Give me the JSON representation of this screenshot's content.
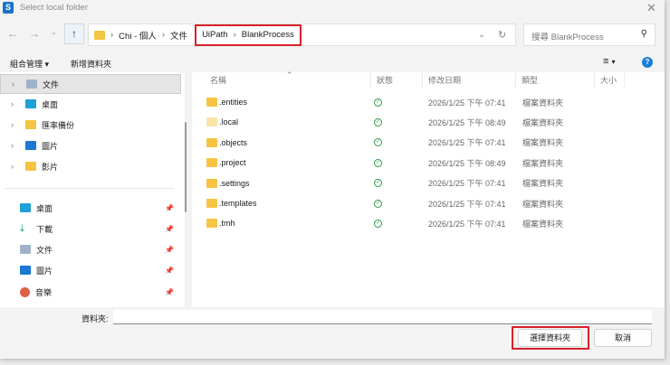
{
  "window": {
    "title": "Select local folder",
    "logo": "S"
  },
  "address": {
    "crumbs": [
      "Chi - 個人",
      "文件"
    ],
    "highlighted": [
      "UiPath",
      "BlankProcess"
    ]
  },
  "search": {
    "placeholder": "搜尋 BlankProcess"
  },
  "toolbar": {
    "organize": "組合管理",
    "new_folder": "新增資料夾"
  },
  "sidebar": {
    "tree": [
      {
        "label": "文件",
        "icon": "documents-icon"
      },
      {
        "label": "桌面",
        "icon": "desktop-icon"
      },
      {
        "label": "匯率備份",
        "icon": "folder-icon"
      },
      {
        "label": "圖片",
        "icon": "pictures-icon"
      },
      {
        "label": "影片",
        "icon": "folder-icon"
      }
    ],
    "quick": [
      {
        "label": "桌面",
        "icon": "desktop-icon"
      },
      {
        "label": "下載",
        "icon": "download-icon"
      },
      {
        "label": "文件",
        "icon": "documents-icon"
      },
      {
        "label": "圖片",
        "icon": "pictures-icon"
      },
      {
        "label": "音樂",
        "icon": "music-icon"
      }
    ]
  },
  "columns": {
    "name": "名稱",
    "status": "狀態",
    "date": "修改日期",
    "type": "類型",
    "size": "大小"
  },
  "files": [
    {
      "name": ".entities",
      "date": "2026/1/25 下午 07:41",
      "type": "檔案資料夾"
    },
    {
      "name": ".local",
      "date": "2026/1/25 下午 08:49",
      "type": "檔案資料夾"
    },
    {
      "name": ".objects",
      "date": "2026/1/25 下午 07:41",
      "type": "檔案資料夾"
    },
    {
      "name": ".project",
      "date": "2026/1/25 下午 08:49",
      "type": "檔案資料夾"
    },
    {
      "name": ".settings",
      "date": "2026/1/25 下午 07:41",
      "type": "檔案資料夾"
    },
    {
      "name": ".templates",
      "date": "2026/1/25 下午 07:41",
      "type": "檔案資料夾"
    },
    {
      "name": ".tmh",
      "date": "2026/1/25 下午 07:41",
      "type": "檔案資料夾"
    }
  ],
  "footer": {
    "folder_label": "資料夾:",
    "folder_value": "",
    "select_button": "選擇資料夾",
    "cancel_button": "取消"
  },
  "colors": {
    "highlight": "#d8202a",
    "status_ok": "#2b9a48"
  }
}
